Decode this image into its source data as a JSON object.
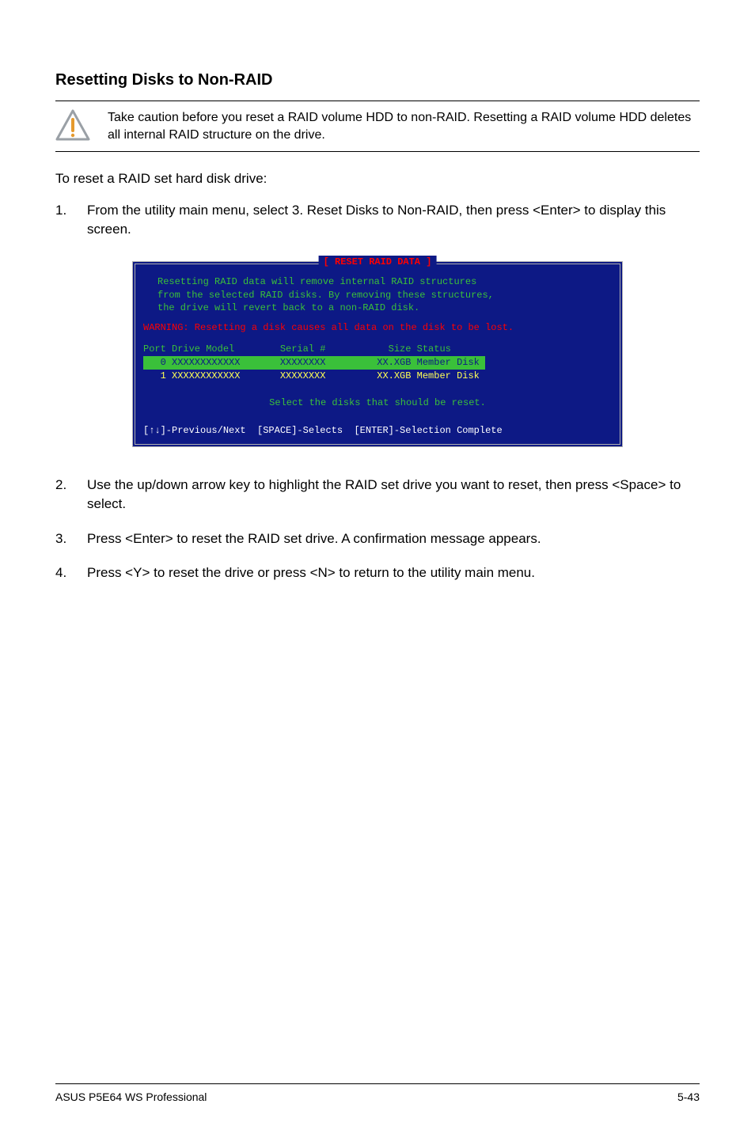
{
  "heading": "Resetting Disks to Non-RAID",
  "note": "Take caution before you reset a RAID volume HDD to non-RAID. Resetting a RAID volume HDD deletes all internal RAID structure on the drive.",
  "intro": "To reset a RAID set hard disk drive:",
  "step1": "From the utility main menu, select 3. Reset Disks to Non-RAID, then press <Enter> to display this screen.",
  "raid": {
    "title": "[ RESET RAID DATA ]",
    "msg1": "Resetting RAID data will remove internal RAID structures",
    "msg2": "from the selected RAID disks. By removing these structures,",
    "msg3": "the drive will revert back to a non-RAID disk.",
    "warn": "WARNING: Resetting a disk causes all data on the disk to be lost.",
    "hdr": "Port Drive Model        Serial #           Size Status",
    "row0": "   0 XXXXXXXXXXXX       XXXXXXXX         XX.XGB Member Disk ",
    "row1": "   1 XXXXXXXXXXXX       XXXXXXXX         XX.XGB Member Disk",
    "instr": "Select the disks that should be reset.",
    "foot": "[↑↓]-Previous/Next  [SPACE]-Selects  [ENTER]-Selection Complete"
  },
  "step2": "Use the up/down arrow key to highlight the RAID set drive you want to reset, then press <Space> to select.",
  "step3": "Press <Enter> to reset the RAID set drive. A confirmation message appears.",
  "step4": "Press <Y> to reset the drive or press <N> to return to the utility main menu.",
  "footer_left": "ASUS P5E64 WS Professional",
  "footer_right": "5-43"
}
